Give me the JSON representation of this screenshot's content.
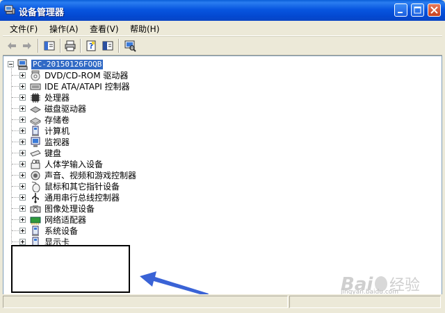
{
  "window": {
    "title": "设备管理器",
    "buttons": [
      "minimize",
      "maximize",
      "close"
    ]
  },
  "menu": [
    {
      "label": "文件(F)"
    },
    {
      "label": "操作(A)"
    },
    {
      "label": "查看(V)"
    },
    {
      "label": "帮助(H)"
    }
  ],
  "toolbar": {
    "icons": [
      "back-arrow-icon",
      "forward-arrow-icon",
      "show-hide-console-tree-icon",
      "print-icon",
      "properties-icon",
      "help-icon",
      "scan-hardware-icon"
    ]
  },
  "tree": {
    "root_label": "PC-20150126FOQB",
    "items": [
      {
        "label": "DVD/CD-ROM 驱动器",
        "icon": "cdrom-icon"
      },
      {
        "label": "IDE ATA/ATAPI 控制器",
        "icon": "ide-controller-icon"
      },
      {
        "label": "处理器",
        "icon": "processor-icon"
      },
      {
        "label": "磁盘驱动器",
        "icon": "disk-drive-icon"
      },
      {
        "label": "存储卷",
        "icon": "storage-volume-icon"
      },
      {
        "label": "计算机",
        "icon": "computer-icon"
      },
      {
        "label": "监视器",
        "icon": "monitor-icon"
      },
      {
        "label": "键盘",
        "icon": "keyboard-icon"
      },
      {
        "label": "人体学输入设备",
        "icon": "hid-icon"
      },
      {
        "label": "声音、视频和游戏控制器",
        "icon": "sound-icon"
      },
      {
        "label": "鼠标和其它指针设备",
        "icon": "mouse-icon"
      },
      {
        "label": "通用串行总线控制器",
        "icon": "usb-icon"
      },
      {
        "label": "图像处理设备",
        "icon": "imaging-device-icon"
      },
      {
        "label": "网络适配器",
        "icon": "network-adapter-icon"
      },
      {
        "label": "系统设备",
        "icon": "system-device-icon"
      },
      {
        "label": "显示卡",
        "icon": "display-adapter-icon"
      }
    ]
  },
  "watermark": {
    "brand": "Bai 经验",
    "url": "jingyan.baidu.com"
  },
  "colors": {
    "titlebar": "#0a5fd8",
    "selection": "#316ac5",
    "arrow": "#3a63d6"
  }
}
